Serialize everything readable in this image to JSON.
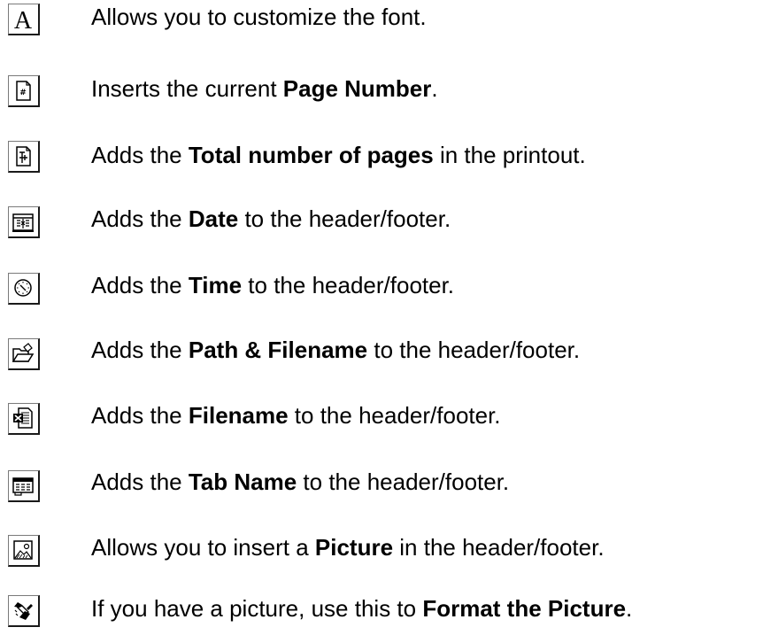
{
  "items": [
    {
      "icon": "font-icon",
      "pre": "Allows you to customize the font.",
      "bold": "",
      "post": ""
    },
    {
      "icon": "page-number-icon",
      "pre": "Inserts the current ",
      "bold": "Page Number",
      "post": "."
    },
    {
      "icon": "total-pages-icon",
      "pre": "Adds the ",
      "bold": "Total number of pages",
      "post": " in the printout."
    },
    {
      "icon": "date-icon",
      "pre": "Adds the ",
      "bold": "Date",
      "post": " to the header/footer."
    },
    {
      "icon": "time-icon",
      "pre": "Adds the ",
      "bold": "Time",
      "post": " to the header/footer."
    },
    {
      "icon": "path-filename-icon",
      "pre": "Adds the ",
      "bold": "Path & Filename",
      "post": " to the header/footer."
    },
    {
      "icon": "filename-icon",
      "pre": "Adds the ",
      "bold": "Filename",
      "post": " to the header/footer."
    },
    {
      "icon": "tab-name-icon",
      "pre": "Adds the ",
      "bold": "Tab Name",
      "post": " to the header/footer."
    },
    {
      "icon": "picture-icon",
      "pre": "Allows you to insert a ",
      "bold": "Picture",
      "post": " in the header/footer."
    },
    {
      "icon": "format-picture-icon",
      "pre": "If you have a picture, use this to ",
      "bold": "Format the Picture",
      "post": "."
    }
  ]
}
